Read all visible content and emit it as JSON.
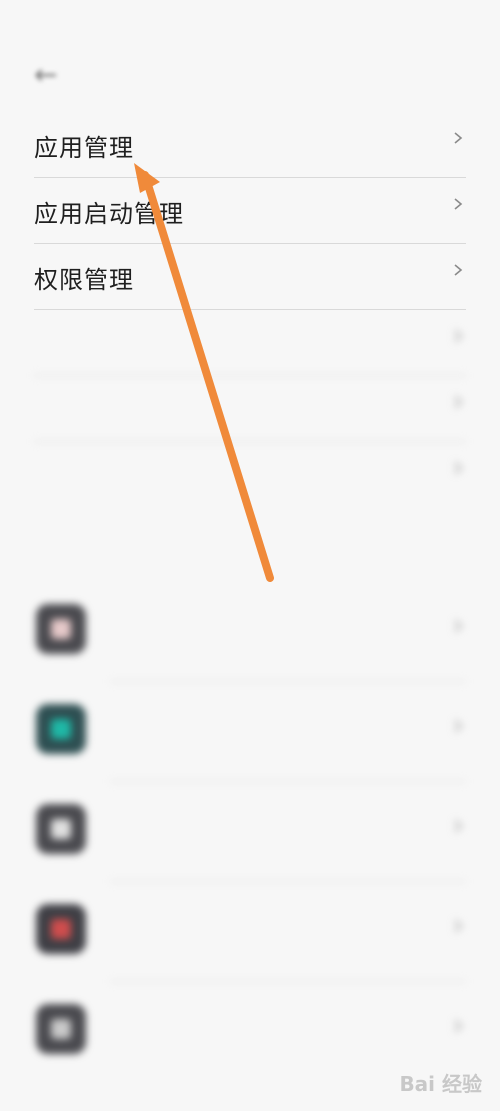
{
  "status_bar": {
    "left": "",
    "right": ""
  },
  "header": {
    "back_icon": "back-arrow-icon",
    "title": ""
  },
  "settings": [
    {
      "label": "应用管理"
    },
    {
      "label": "应用启动管理"
    },
    {
      "label": "权限管理"
    }
  ],
  "blurred_settings": [
    {
      "label": "",
      "value": ""
    },
    {
      "label": "",
      "value": ""
    },
    {
      "label": "",
      "value": ""
    }
  ],
  "section_label": "",
  "apps": [
    {
      "name": "",
      "icon_color": "#4a4a4f",
      "inner_color": "#e6c9c9"
    },
    {
      "name": "",
      "icon_color": "#2e4f52",
      "inner_color": "#1fb8a6"
    },
    {
      "name": "",
      "icon_color": "#4a4a4f",
      "inner_color": "#e0e0e0"
    },
    {
      "name": "",
      "icon_color": "#3f3f45",
      "inner_color": "#cf4d4d"
    },
    {
      "name": "",
      "icon_color": "#4a4a4f",
      "inner_color": "#c9c9c9"
    }
  ],
  "watermark": "Bai 经验",
  "colors": {
    "arrow": "#f08a3a",
    "background": "#f7f7f7"
  }
}
